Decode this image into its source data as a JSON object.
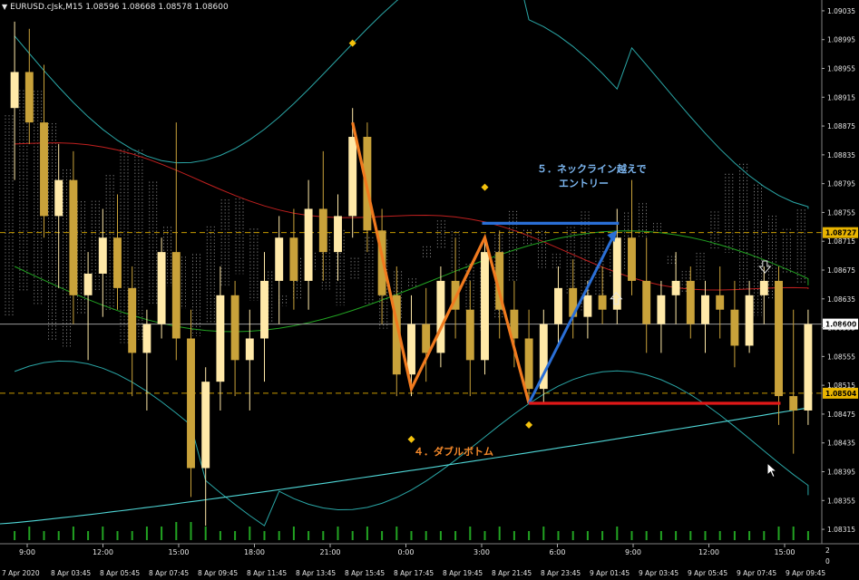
{
  "header": {
    "symbol_line": "EURUSD.cJsk,M15  1.08596 1.08668 1.08578 1.08600"
  },
  "annotations": {
    "double_bottom": "４．ダブルボトム",
    "neckline_line1": "５．ネックライン越えで",
    "neckline_line2": "エントリー"
  },
  "colors": {
    "background": "#000000",
    "bull_candle": "#ffe9a8",
    "bear_candle": "#c9a23a",
    "cloud_dots": "#d8d8d8",
    "bollinger": "#2aa6a6",
    "ma_red": "#c0201f",
    "ma_green": "#22a322",
    "long_ma": "#4fd6d6",
    "zigzag": "#f07a1e",
    "entry_arrow": "#2a6fd6",
    "neckline": "#2a6fd6",
    "support": "#e01818",
    "marker": "#f4c20d",
    "price_tag_yellow": "#e8b400",
    "volume": "#22a322"
  },
  "chart_data": {
    "type": "candlestick",
    "symbol": "EURUSD.cJsk",
    "timeframe": "M15",
    "ylim": [
      1.083,
      1.0905
    ],
    "y_ticks": [
      "1.09035",
      "1.08995",
      "1.08955",
      "1.08915",
      "1.08875",
      "1.08835",
      "1.08795",
      "1.08755",
      "1.08715",
      "1.08675",
      "1.08635",
      "1.08595",
      "1.08555",
      "1.08515",
      "1.08475",
      "1.08435",
      "1.08395",
      "1.08355",
      "1.08315"
    ],
    "y_tick_values": [
      1.09035,
      1.08995,
      1.08955,
      1.08915,
      1.08875,
      1.08835,
      1.08795,
      1.08755,
      1.08715,
      1.08675,
      1.08635,
      1.08595,
      1.08555,
      1.08515,
      1.08475,
      1.08435,
      1.08395,
      1.08355,
      1.08315
    ],
    "hour_labels": [
      "9:00",
      "12:00",
      "15:00",
      "18:00",
      "21:00",
      "0:00",
      "3:00",
      "6:00",
      "9:00",
      "12:00",
      "15:00"
    ],
    "date_labels": [
      "7 Apr 2020",
      "8 Apr 03:45",
      "8 Apr 05:45",
      "8 Apr 07:45",
      "8 Apr 09:45",
      "8 Apr 11:45",
      "8 Apr 13:45",
      "8 Apr 15:45",
      "8 Apr 17:45",
      "8 Apr 19:45",
      "8 Apr 21:45",
      "8 Apr 23:45",
      "9 Apr 01:45",
      "9 Apr 03:45",
      "9 Apr 05:45",
      "9 Apr 07:45",
      "9 Apr 09:45"
    ],
    "price_tags": [
      {
        "label": "1.08727",
        "value": 1.08727,
        "style": "yellow"
      },
      {
        "label": "1.08600",
        "value": 1.086,
        "style": "white"
      },
      {
        "label": "1.08504",
        "value": 1.08504,
        "style": "yellow"
      }
    ],
    "volume_axis_labels": [
      "2",
      "0"
    ],
    "zigzag_points": [
      {
        "label": "peak-1",
        "price": 1.0888
      },
      {
        "label": "bottom-1",
        "price": 1.0851
      },
      {
        "label": "middle-peak",
        "price": 1.0872
      },
      {
        "label": "bottom-2",
        "price": 1.0849
      },
      {
        "label": "breakout",
        "price": 1.0873
      }
    ],
    "neckline_price": 1.0874,
    "support_price": 1.0849,
    "candles": [
      {
        "o": 1.089,
        "h": 1.0902,
        "l": 1.088,
        "c": 1.0895
      },
      {
        "o": 1.0895,
        "h": 1.0901,
        "l": 1.0885,
        "c": 1.0888
      },
      {
        "o": 1.0888,
        "h": 1.0896,
        "l": 1.0872,
        "c": 1.0875
      },
      {
        "o": 1.0875,
        "h": 1.0885,
        "l": 1.0865,
        "c": 1.088
      },
      {
        "o": 1.088,
        "h": 1.0884,
        "l": 1.086,
        "c": 1.0864
      },
      {
        "o": 1.0864,
        "h": 1.087,
        "l": 1.0855,
        "c": 1.0867
      },
      {
        "o": 1.0867,
        "h": 1.0876,
        "l": 1.0861,
        "c": 1.0872
      },
      {
        "o": 1.0872,
        "h": 1.0878,
        "l": 1.0862,
        "c": 1.0865
      },
      {
        "o": 1.0865,
        "h": 1.0868,
        "l": 1.085,
        "c": 1.0856
      },
      {
        "o": 1.0856,
        "h": 1.0862,
        "l": 1.0848,
        "c": 1.086
      },
      {
        "o": 1.086,
        "h": 1.0872,
        "l": 1.0858,
        "c": 1.087
      },
      {
        "o": 1.087,
        "h": 1.0888,
        "l": 1.0855,
        "c": 1.0858
      },
      {
        "o": 1.0858,
        "h": 1.0862,
        "l": 1.0836,
        "c": 1.084
      },
      {
        "o": 1.084,
        "h": 1.0854,
        "l": 1.0832,
        "c": 1.0852
      },
      {
        "o": 1.0852,
        "h": 1.0868,
        "l": 1.0848,
        "c": 1.0864
      },
      {
        "o": 1.0864,
        "h": 1.0866,
        "l": 1.085,
        "c": 1.0855
      },
      {
        "o": 1.0855,
        "h": 1.0862,
        "l": 1.0848,
        "c": 1.0858
      },
      {
        "o": 1.0858,
        "h": 1.087,
        "l": 1.0852,
        "c": 1.0866
      },
      {
        "o": 1.0866,
        "h": 1.0875,
        "l": 1.086,
        "c": 1.0872
      },
      {
        "o": 1.0872,
        "h": 1.0876,
        "l": 1.0862,
        "c": 1.0866
      },
      {
        "o": 1.0866,
        "h": 1.088,
        "l": 1.0862,
        "c": 1.0876
      },
      {
        "o": 1.0876,
        "h": 1.0884,
        "l": 1.0866,
        "c": 1.087
      },
      {
        "o": 1.087,
        "h": 1.0878,
        "l": 1.0866,
        "c": 1.0875
      },
      {
        "o": 1.0875,
        "h": 1.089,
        "l": 1.0872,
        "c": 1.0886
      },
      {
        "o": 1.0886,
        "h": 1.0888,
        "l": 1.087,
        "c": 1.0873
      },
      {
        "o": 1.0873,
        "h": 1.0876,
        "l": 1.086,
        "c": 1.0864
      },
      {
        "o": 1.0864,
        "h": 1.0868,
        "l": 1.085,
        "c": 1.0853
      },
      {
        "o": 1.0853,
        "h": 1.0864,
        "l": 1.085,
        "c": 1.086
      },
      {
        "o": 1.086,
        "h": 1.0865,
        "l": 1.0852,
        "c": 1.0856
      },
      {
        "o": 1.0856,
        "h": 1.0868,
        "l": 1.0854,
        "c": 1.0866
      },
      {
        "o": 1.0866,
        "h": 1.0872,
        "l": 1.0858,
        "c": 1.0862
      },
      {
        "o": 1.0862,
        "h": 1.0866,
        "l": 1.085,
        "c": 1.0855
      },
      {
        "o": 1.0855,
        "h": 1.0872,
        "l": 1.0853,
        "c": 1.087
      },
      {
        "o": 1.087,
        "h": 1.0873,
        "l": 1.0858,
        "c": 1.0862
      },
      {
        "o": 1.0862,
        "h": 1.0866,
        "l": 1.0854,
        "c": 1.0858
      },
      {
        "o": 1.0858,
        "h": 1.0862,
        "l": 1.0849,
        "c": 1.0851
      },
      {
        "o": 1.0851,
        "h": 1.0862,
        "l": 1.0849,
        "c": 1.086
      },
      {
        "o": 1.086,
        "h": 1.0868,
        "l": 1.0857,
        "c": 1.0865
      },
      {
        "o": 1.0865,
        "h": 1.0869,
        "l": 1.0858,
        "c": 1.0861
      },
      {
        "o": 1.0861,
        "h": 1.0866,
        "l": 1.0858,
        "c": 1.0864
      },
      {
        "o": 1.0864,
        "h": 1.0868,
        "l": 1.086,
        "c": 1.0862
      },
      {
        "o": 1.0862,
        "h": 1.0876,
        "l": 1.086,
        "c": 1.0872
      },
      {
        "o": 1.0872,
        "h": 1.088,
        "l": 1.0864,
        "c": 1.0866
      },
      {
        "o": 1.0866,
        "h": 1.0872,
        "l": 1.0856,
        "c": 1.086
      },
      {
        "o": 1.086,
        "h": 1.0866,
        "l": 1.0856,
        "c": 1.0864
      },
      {
        "o": 1.0864,
        "h": 1.087,
        "l": 1.086,
        "c": 1.0866
      },
      {
        "o": 1.0866,
        "h": 1.0868,
        "l": 1.0858,
        "c": 1.086
      },
      {
        "o": 1.086,
        "h": 1.0866,
        "l": 1.0856,
        "c": 1.0864
      },
      {
        "o": 1.0864,
        "h": 1.0868,
        "l": 1.0858,
        "c": 1.0862
      },
      {
        "o": 1.0862,
        "h": 1.0866,
        "l": 1.0854,
        "c": 1.0857
      },
      {
        "o": 1.0857,
        "h": 1.0866,
        "l": 1.0856,
        "c": 1.0864
      },
      {
        "o": 1.0864,
        "h": 1.0868,
        "l": 1.086,
        "c": 1.0866
      },
      {
        "o": 1.0866,
        "h": 1.0868,
        "l": 1.0846,
        "c": 1.085
      },
      {
        "o": 1.085,
        "h": 1.0862,
        "l": 1.0842,
        "c": 1.0848
      },
      {
        "o": 1.0848,
        "h": 1.0862,
        "l": 1.0846,
        "c": 1.086
      }
    ],
    "volumes": [
      2,
      3,
      2,
      2,
      3,
      2,
      3,
      2,
      2,
      3,
      3,
      4,
      4,
      3,
      2,
      2,
      3,
      2,
      2,
      3,
      2,
      2,
      3,
      2,
      3,
      2,
      3,
      2,
      2,
      2,
      2,
      3,
      2,
      3,
      2,
      2,
      3,
      2,
      2,
      2,
      2,
      3,
      2,
      2,
      2,
      2,
      2,
      2,
      2,
      2,
      2,
      2,
      3,
      3,
      2
    ]
  }
}
